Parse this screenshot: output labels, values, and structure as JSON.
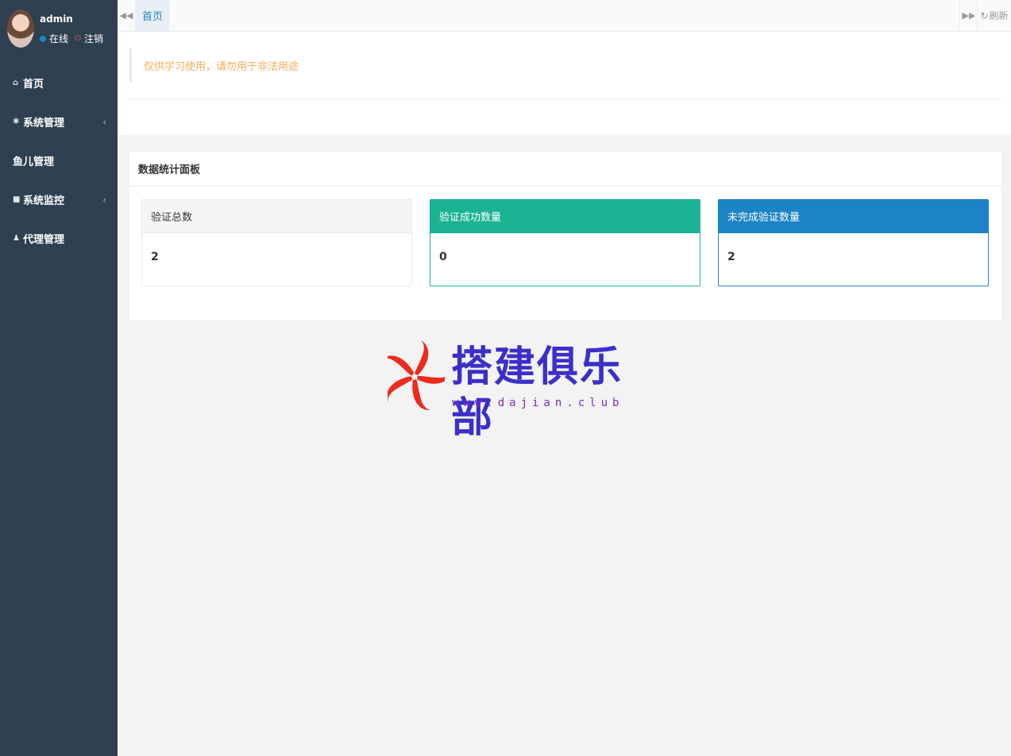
{
  "user": {
    "name": "admin",
    "status": "在线",
    "logout": "注销"
  },
  "sidebar": {
    "items": [
      {
        "label": "首页",
        "icon": "home-icon",
        "glyph": "⌂",
        "has_children": false
      },
      {
        "label": "系统管理",
        "icon": "gear-icon",
        "glyph": "✱",
        "has_children": true
      },
      {
        "label": "鱼儿管理",
        "icon": "",
        "glyph": "",
        "has_children": false
      },
      {
        "label": "系统监控",
        "icon": "video-icon",
        "glyph": "■",
        "has_children": true
      },
      {
        "label": "代理管理",
        "icon": "user-icon",
        "glyph": "♟",
        "has_children": false
      }
    ]
  },
  "tabs": {
    "home": "首页",
    "refresh": "刷新"
  },
  "notice": "仅供学习使用，请勿用于非法用途",
  "panel": {
    "title": "数据统计面板",
    "stats": [
      {
        "label": "验证总数",
        "value": "2"
      },
      {
        "label": "验证成功数量",
        "value": "0"
      },
      {
        "label": "未完成验证数量",
        "value": "2"
      }
    ]
  },
  "watermark": {
    "title": "搭建俱乐部",
    "url": "www.dajian.club"
  },
  "colors": {
    "sidebar": "#2f4050",
    "success": "#1ab394",
    "primary": "#1c84c6",
    "warning": "#f8ac59",
    "danger": "#ed5565"
  }
}
